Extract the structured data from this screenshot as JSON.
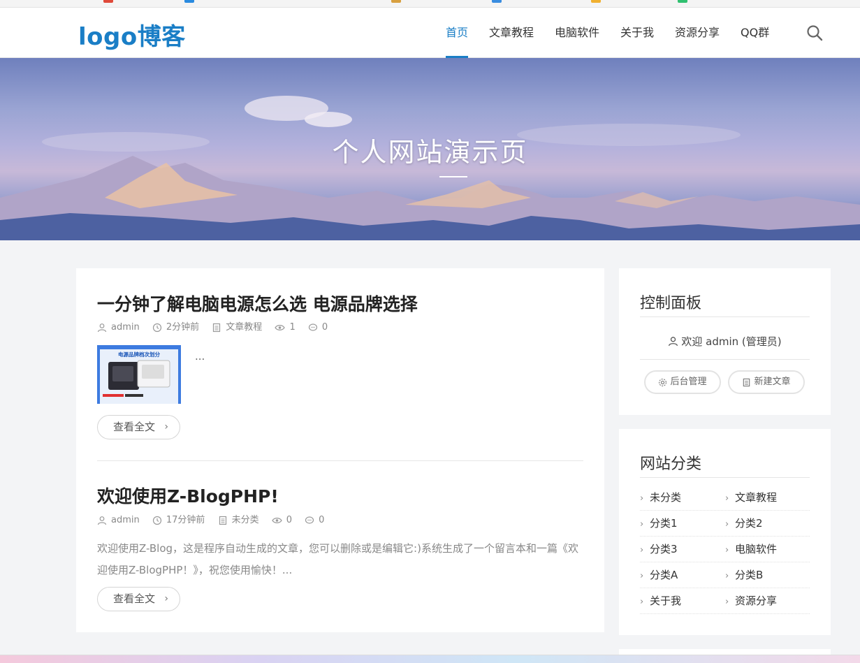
{
  "site": {
    "logo": "logo博客"
  },
  "nav": [
    {
      "label": "首页",
      "active": true
    },
    {
      "label": "文章教程"
    },
    {
      "label": "电脑软件"
    },
    {
      "label": "关于我"
    },
    {
      "label": "资源分享"
    },
    {
      "label": "QQ群"
    }
  ],
  "banner": {
    "title": "个人网站演示页"
  },
  "posts": [
    {
      "title": "一分钟了解电脑电源怎么选 电源品牌选择",
      "author": "admin",
      "time": "2分钟前",
      "category": "文章教程",
      "views": "1",
      "comments": "0",
      "thumb_caption": "电源品牌档次划分",
      "excerpt": "...",
      "readmore": "查看全文"
    },
    {
      "title": "欢迎使用Z-BlogPHP!",
      "author": "admin",
      "time": "17分钟前",
      "category": "未分类",
      "views": "0",
      "comments": "0",
      "excerpt": "欢迎使用Z-Blog，这是程序自动生成的文章，您可以删除或是编辑它:)系统生成了一个留言本和一篇《欢迎使用Z-BlogPHP！》，祝您使用愉快！...",
      "readmore": "查看全文"
    }
  ],
  "control_panel": {
    "title": "控制面板",
    "welcome": "欢迎 admin (管理员)",
    "admin_button": "后台管理",
    "new_post_button": "新建文章"
  },
  "categories": {
    "title": "网站分类",
    "items": [
      "未分类",
      "文章教程",
      "分类1",
      "分类2",
      "分类3",
      "电脑软件",
      "分类A",
      "分类B",
      "关于我",
      "资源分享"
    ]
  },
  "colors": {
    "accent": "#1a7ec6"
  }
}
